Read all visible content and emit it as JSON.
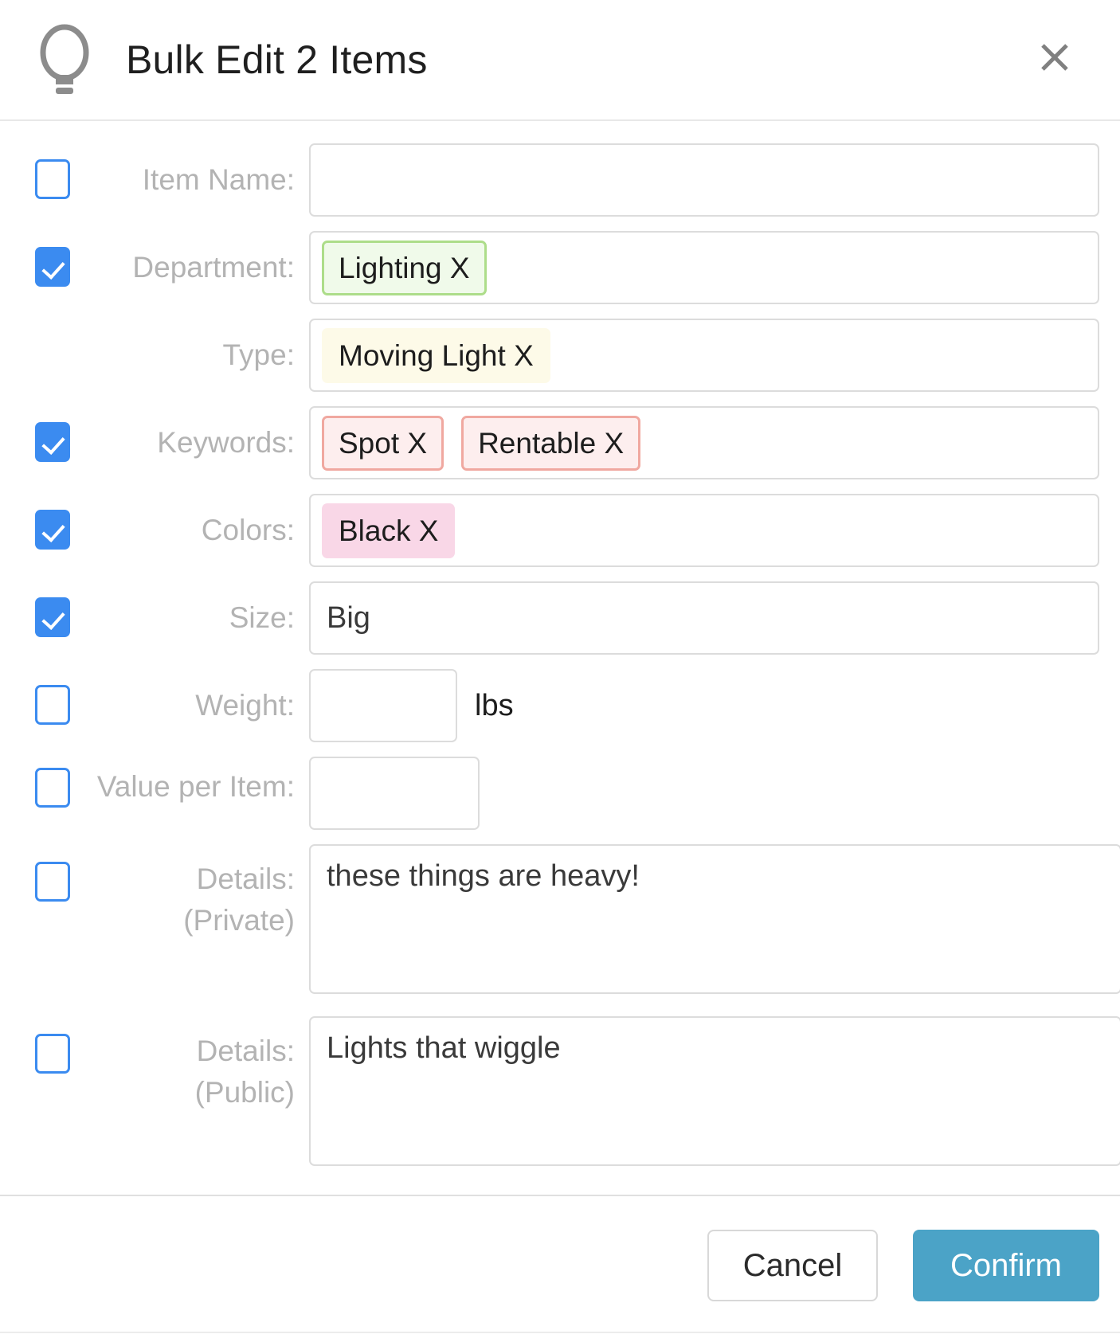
{
  "header": {
    "icon": "lightbulb-icon",
    "title": "Bulk Edit 2 Items",
    "close_label": "X"
  },
  "form": {
    "rows": [
      {
        "name": "item-name",
        "label": "Item Name:",
        "checkbox": true,
        "checked": false,
        "field_type": "text",
        "value": "",
        "tags": []
      },
      {
        "name": "department",
        "label": "Department:",
        "checkbox": true,
        "checked": true,
        "field_type": "tags",
        "value": "",
        "tags": [
          {
            "text": "Lighting X",
            "style": "green"
          }
        ]
      },
      {
        "name": "type",
        "label": "Type:",
        "checkbox": false,
        "checked": false,
        "field_type": "tags",
        "value": "",
        "tags": [
          {
            "text": "Moving Light X",
            "style": "yellow"
          }
        ]
      },
      {
        "name": "keywords",
        "label": "Keywords:",
        "checkbox": true,
        "checked": true,
        "field_type": "tags",
        "value": "",
        "tags": [
          {
            "text": "Spot X",
            "style": "salmon"
          },
          {
            "text": "Rentable X",
            "style": "salmon"
          }
        ]
      },
      {
        "name": "colors",
        "label": "Colors:",
        "checkbox": true,
        "checked": true,
        "field_type": "tags",
        "value": "",
        "tags": [
          {
            "text": "Black X",
            "style": "pink"
          }
        ]
      },
      {
        "name": "size",
        "label": "Size:",
        "checkbox": true,
        "checked": true,
        "field_type": "text",
        "value": "Big",
        "tags": []
      },
      {
        "name": "weight",
        "label": "Weight:",
        "checkbox": true,
        "checked": false,
        "field_type": "text-unit",
        "value": "",
        "unit": "lbs",
        "tags": []
      },
      {
        "name": "value-per-item",
        "label": "Value per Item:",
        "checkbox": true,
        "checked": false,
        "field_type": "text-narrow",
        "value": "",
        "tags": []
      },
      {
        "name": "details-private",
        "label": "Details:",
        "sub_label": "(Private)",
        "checkbox": true,
        "checked": false,
        "field_type": "textarea",
        "value": "these things are heavy!",
        "tags": []
      },
      {
        "name": "details-public",
        "label": "Details:",
        "sub_label": "(Public)",
        "checkbox": true,
        "checked": false,
        "field_type": "textarea",
        "value": "Lights that wiggle",
        "tags": []
      }
    ]
  },
  "footer": {
    "cancel_label": "Cancel",
    "confirm_label": "Confirm"
  },
  "colors": {
    "accent_blue": "#3b8bf0",
    "confirm_teal": "#4ba3c7",
    "label_gray": "#b3b3b3",
    "border_gray": "#dcdcdc",
    "tag_green_bg": "#f0faea",
    "tag_green_border": "#addd8a",
    "tag_yellow_bg": "#fdfae8",
    "tag_salmon_bg": "#fdeeee",
    "tag_salmon_border": "#f0a8a0",
    "tag_pink_bg": "#f9d7e7"
  }
}
